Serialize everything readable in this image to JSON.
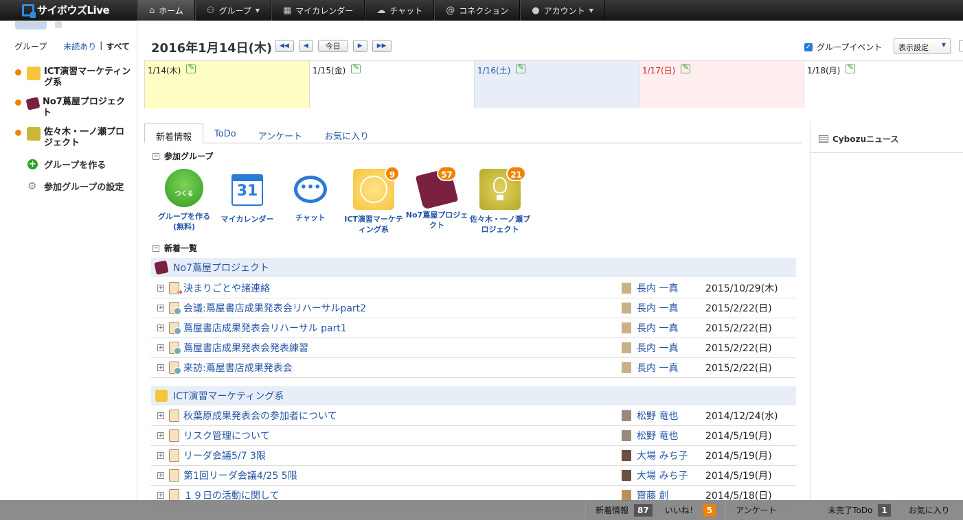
{
  "nav": {
    "logo": "サイボウズLive",
    "items": [
      {
        "label": "ホーム",
        "icon": "home-icon"
      },
      {
        "label": "グループ",
        "icon": "group-icon"
      },
      {
        "label": "マイカレンダー",
        "icon": "calendar-icon"
      },
      {
        "label": "チャット",
        "icon": "chat-icon"
      },
      {
        "label": "コネクション",
        "icon": "at-icon"
      },
      {
        "label": "アカウント",
        "icon": "user-icon"
      }
    ]
  },
  "sidebar": {
    "tab_group": "グループ",
    "tab_unread": "未読あり",
    "sep": "|",
    "tab_all": "すべて",
    "groups": [
      {
        "label": "ICT演習マーケティング系",
        "color": "#f5c53c"
      },
      {
        "label": "No7蔦屋プロジェクト",
        "color": "#7a2040"
      },
      {
        "label": "佐々木・一ノ瀬プロジェクト",
        "color": "#c9b838"
      }
    ],
    "create_group": "グループを作る",
    "group_settings": "参加グループの設定"
  },
  "header": {
    "date": "2016年1月14日(木)",
    "btn_first": "◀◀",
    "btn_prev": "◀",
    "btn_today": "今日",
    "btn_next": "▶",
    "btn_last": "▶▶",
    "group_event": "グループイベント",
    "display_settings": "表示設定"
  },
  "calendar": [
    {
      "label": "1/14(木)",
      "bg": "#ffffc4",
      "color": "#222"
    },
    {
      "label": "1/15(金)",
      "bg": "#ffffff",
      "color": "#222"
    },
    {
      "label": "1/16(土)",
      "bg": "#e8eef8",
      "color": "#2456a6"
    },
    {
      "label": "1/17(日)",
      "bg": "#ffeeee",
      "color": "#d21e1e"
    },
    {
      "label": "1/18(月)",
      "bg": "#ffffff",
      "color": "#222"
    }
  ],
  "tabs": [
    "新着情報",
    "ToDo",
    "アンケート",
    "お気に入り"
  ],
  "sections": {
    "joined": "参加グループ",
    "news": "新着一覧"
  },
  "apps": [
    {
      "label": "グループを作る(無料)",
      "badge": "",
      "icon": "create-group-icon"
    },
    {
      "label": "マイカレンダー",
      "badge": "",
      "icon": "calendar-icon",
      "day": "31"
    },
    {
      "label": "チャット",
      "badge": "",
      "icon": "chat-icon"
    },
    {
      "label": "ICT演習マーケティング系",
      "badge": "9",
      "icon": "globe-icon"
    },
    {
      "label": "No7蔦屋プロジェクト",
      "badge": "57",
      "icon": "book-icon"
    },
    {
      "label": "佐々木・一ノ瀬プロジェクト",
      "badge": "21",
      "icon": "lightbulb-icon"
    }
  ],
  "news_groups": [
    {
      "name": "No7蔦屋プロジェクト",
      "rows": [
        {
          "title": "決まりごとや諸連絡",
          "user": "長内 一真",
          "date": "2015/10/29(木)",
          "kind": "arrow"
        },
        {
          "title": "会議:蔦屋書店成果発表会リハーサルpart2",
          "user": "長内 一真",
          "date": "2015/2/22(日)",
          "kind": "meeting"
        },
        {
          "title": "蔦屋書店成果発表会リハーサル part1",
          "user": "長内 一真",
          "date": "2015/2/22(日)",
          "kind": "meeting"
        },
        {
          "title": "蔦屋書店成果発表会発表練習",
          "user": "長内 一真",
          "date": "2015/2/22(日)",
          "kind": "meeting"
        },
        {
          "title": "来訪:蔦屋書店成果発表会",
          "user": "長内 一真",
          "date": "2015/2/22(日)",
          "kind": "meeting"
        }
      ]
    },
    {
      "name": "ICT演習マーケティング系",
      "rows": [
        {
          "title": "秋葉原成果発表会の参加者について",
          "user": "松野 竜也",
          "date": "2014/12/24(水)",
          "kind": "topic"
        },
        {
          "title": "リスク管理について",
          "user": "松野 竜也",
          "date": "2014/5/19(月)",
          "kind": "topic"
        },
        {
          "title": "リーダ会議5/7 3限",
          "user": "大場 みち子",
          "date": "2014/5/19(月)",
          "kind": "topic"
        },
        {
          "title": "第1回リーダ会議4/25 5限",
          "user": "大場 みち子",
          "date": "2014/5/19(月)",
          "kind": "topic"
        },
        {
          "title": "１９日の活動に関して",
          "user": "齋藤 創",
          "date": "2014/5/18(日)",
          "kind": "topic"
        }
      ]
    }
  ],
  "right_panel": {
    "title": "Cybozuニュース"
  },
  "bottom_bar": {
    "news_label": "新着情報",
    "news_count": "87",
    "like_label": "いいね！",
    "like_count": "5",
    "survey_label": "アンケート",
    "todo_label": "未完了ToDo",
    "todo_count": "1",
    "fav_label": "お気に入り"
  }
}
